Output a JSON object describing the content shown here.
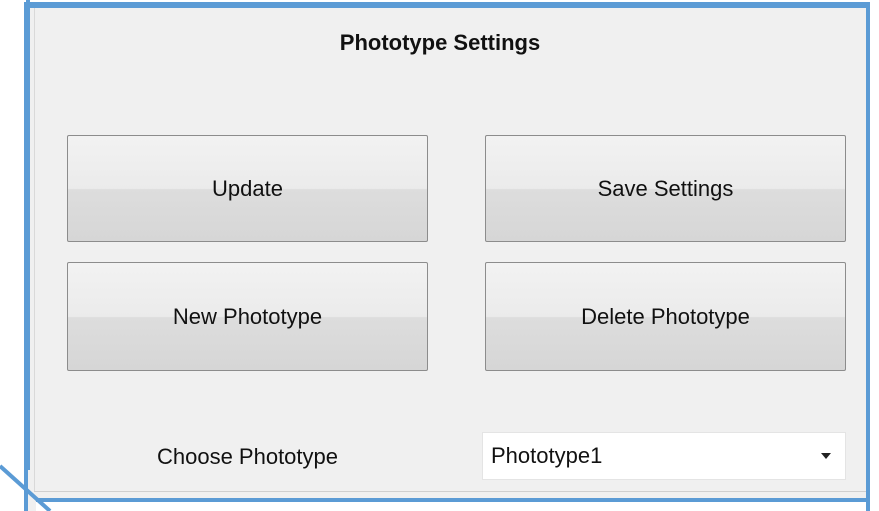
{
  "panel": {
    "title": "Phototype Settings"
  },
  "buttons": {
    "update": "Update",
    "save_settings": "Save Settings",
    "new_phototype": "New Phototype",
    "delete_phototype": "Delete Phototype"
  },
  "chooser": {
    "label": "Choose Phototype",
    "selected": "Phototype1"
  },
  "colors": {
    "frame_accent": "#5b9bd5",
    "panel_background": "#f0f0f0"
  }
}
